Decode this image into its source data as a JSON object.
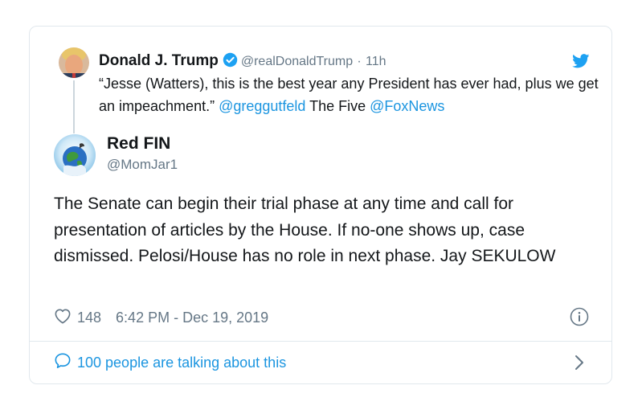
{
  "quoted_tweet": {
    "name": "Donald J. Trump",
    "handle": "@realDonaldTrump",
    "separator": "·",
    "time": "11h",
    "text_quote": "“Jesse (Watters), this is the best year any President has ever had, plus we get an impeachment.” ",
    "mention_1": "@greggutfeld",
    "text_mid": " The Five ",
    "mention_2": "@FoxNews"
  },
  "tweet": {
    "name": "Red FIN",
    "handle": "@MomJar1",
    "text": "The Senate can begin their trial phase at any time and call for presentation of articles by the House.  If no-one shows up, case dismissed.  Pelosi/House has no role in next phase. Jay SEKULOW",
    "likes": "148",
    "timestamp": "6:42 PM - Dec 19, 2019"
  },
  "footer": {
    "talking_label": "100 people are talking about this"
  },
  "icons": {
    "verified": "verified-badge-icon",
    "bird": "twitter-bird-icon",
    "heart": "heart-icon",
    "info": "info-icon",
    "bubble": "chat-bubble-icon",
    "chevron": "chevron-right-icon"
  },
  "colors": {
    "link_blue": "#1b95e0",
    "secondary_gray": "#657786",
    "border": "#e1e8ed"
  }
}
